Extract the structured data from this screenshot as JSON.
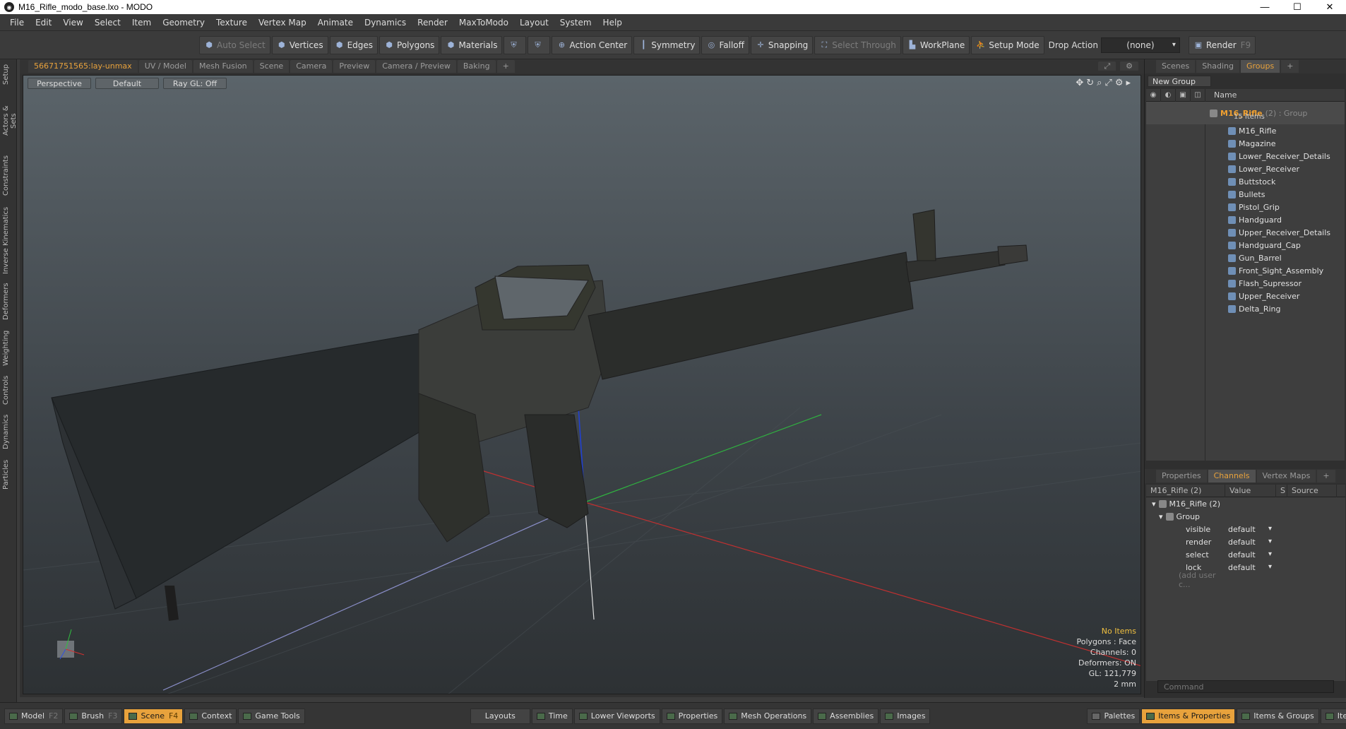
{
  "window": {
    "title": "M16_Rifle_modo_base.lxo - MODO",
    "app_icon": "modo-logo-icon"
  },
  "menu": [
    "File",
    "Edit",
    "View",
    "Select",
    "Item",
    "Geometry",
    "Texture",
    "Vertex Map",
    "Animate",
    "Dynamics",
    "Render",
    "MaxToModo",
    "Layout",
    "System",
    "Help"
  ],
  "toolbar": {
    "auto_select": "Auto Select",
    "vertices": "Vertices",
    "edges": "Edges",
    "polygons": "Polygons",
    "materials": "Materials",
    "action_center": "Action Center",
    "symmetry": "Symmetry",
    "falloff": "Falloff",
    "snapping": "Snapping",
    "select_through": "Select Through",
    "workplane": "WorkPlane",
    "setup_mode": "Setup Mode",
    "drop_action": "Drop Action",
    "drop_value": "(none)",
    "render": "Render",
    "render_key": "F9"
  },
  "left_tabs": [
    "Setup",
    "Actors & Sets",
    "Constraints",
    "Inverse Kinematics",
    "Deformers",
    "Weighting",
    "Controls",
    "Dynamics",
    "Particles"
  ],
  "viewport_tabs": [
    "56671751565:lay-unmax",
    "UV / Model",
    "Mesh Fusion",
    "Scene",
    "Camera",
    "Preview",
    "Camera / Preview",
    "Baking",
    "+"
  ],
  "viewport_bar": {
    "projection": "Perspective",
    "style": "Default",
    "raygl": "Ray GL: Off"
  },
  "stats": {
    "selection": "No Items",
    "polygons": "Polygons : Face",
    "channels": "Channels: 0",
    "deformers": "Deformers: ON",
    "gl": "GL: 121,779",
    "scale": "2 mm"
  },
  "panel_tabs": [
    "Scenes",
    "Shading",
    "Groups",
    "+"
  ],
  "new_group": "New Group",
  "list_header": "Name",
  "group": {
    "name": "M16_Rifle",
    "suffix": "(2) : Group",
    "count": "15 Items"
  },
  "items": [
    "M16_Rifle",
    "Magazine",
    "Lower_Receiver_Details",
    "Lower_Receiver",
    "Buttstock",
    "Bullets",
    "Pistol_Grip",
    "Handguard",
    "Upper_Receiver_Details",
    "Handguard_Cap",
    "Gun_Barrel",
    "Front_Sight_Assembly",
    "Flash_Supressor",
    "Upper_Receiver",
    "Delta_Ring"
  ],
  "lower_tabs": [
    "Properties",
    "Channels",
    "Vertex Maps",
    "+"
  ],
  "channels_header": {
    "name": "M16_Rifle (2)",
    "value": "Value",
    "s": "S",
    "source": "Source"
  },
  "channels": {
    "root": "M16_Rifle (2)",
    "group": "Group",
    "rows": [
      {
        "k": "visible",
        "v": "default"
      },
      {
        "k": "render",
        "v": "default"
      },
      {
        "k": "select",
        "v": "default"
      },
      {
        "k": "lock",
        "v": "default"
      }
    ],
    "add": "(add user c..."
  },
  "command_placeholder": "Command",
  "bottom_left": [
    {
      "label": "Model",
      "key": "F2"
    },
    {
      "label": "Brush",
      "key": "F3"
    },
    {
      "label": "Scene",
      "key": "F4"
    },
    {
      "label": "Context",
      "key": ""
    },
    {
      "label": "Game Tools",
      "key": ""
    }
  ],
  "bottom_mid": [
    "Layouts",
    "Time",
    "Lower Viewports",
    "Properties",
    "Mesh Operations",
    "Assemblies",
    "Images"
  ],
  "bottom_right": [
    "Palettes",
    "Items & Properties",
    "Items & Groups",
    "Items & Shading"
  ],
  "colors": {
    "accent": "#e8a23c",
    "x_axis": "#d03030",
    "y_axis": "#30c040",
    "z_axis": "#3050e0"
  }
}
